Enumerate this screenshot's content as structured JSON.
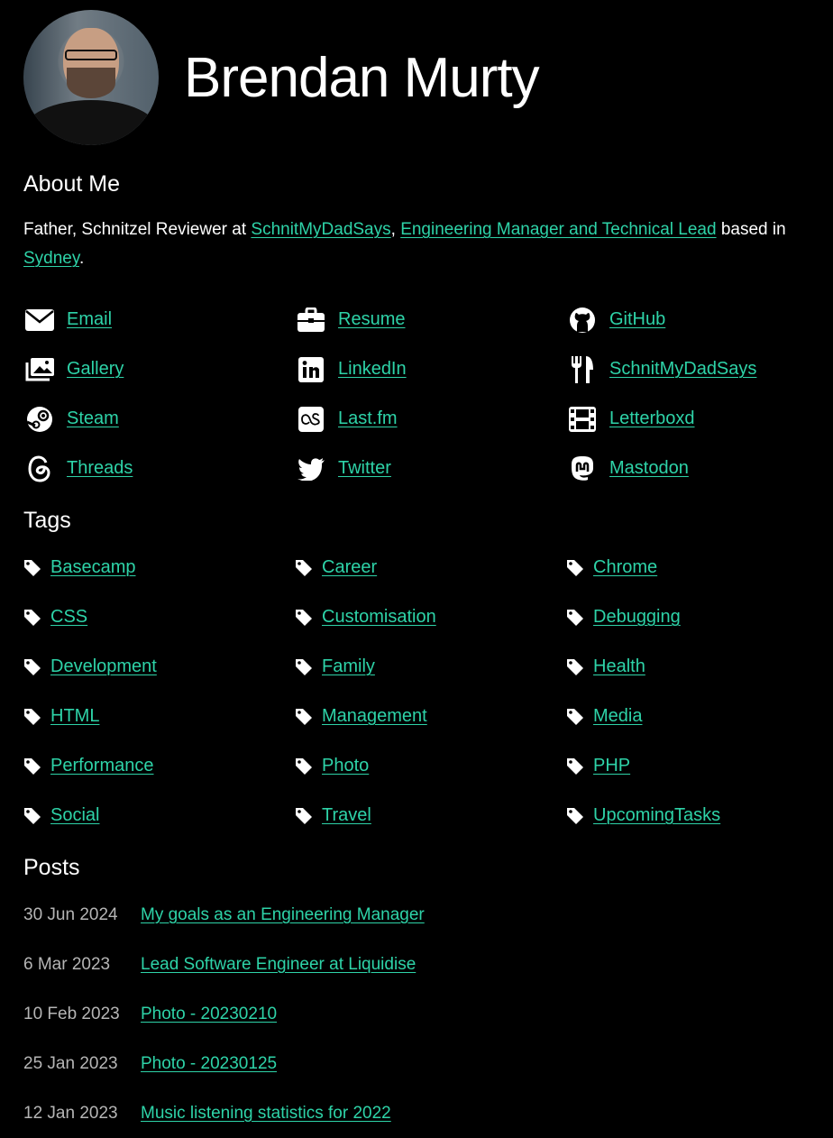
{
  "profile": {
    "name": "Brendan Murty"
  },
  "about": {
    "heading": "About Me",
    "text_1": "Father, Schnitzel Reviewer at ",
    "link_1": "SchnitMyDadSays",
    "text_2": ", ",
    "link_2": "Engineering Manager and Technical Lead",
    "text_3": " based in ",
    "link_3": "Sydney",
    "text_4": "."
  },
  "social": [
    {
      "label": "Email",
      "icon": "email-icon"
    },
    {
      "label": "Resume",
      "icon": "briefcase-icon"
    },
    {
      "label": "GitHub",
      "icon": "github-icon"
    },
    {
      "label": "Gallery",
      "icon": "gallery-icon"
    },
    {
      "label": "LinkedIn",
      "icon": "linkedin-icon"
    },
    {
      "label": "SchnitMyDadSays",
      "icon": "utensils-icon"
    },
    {
      "label": "Steam",
      "icon": "steam-icon"
    },
    {
      "label": "Last.fm",
      "icon": "lastfm-icon"
    },
    {
      "label": "Letterboxd",
      "icon": "film-icon"
    },
    {
      "label": "Threads",
      "icon": "threads-icon"
    },
    {
      "label": "Twitter",
      "icon": "twitter-icon"
    },
    {
      "label": "Mastodon",
      "icon": "mastodon-icon"
    }
  ],
  "tags": {
    "heading": "Tags",
    "items": [
      "Basecamp",
      "Career",
      "Chrome",
      "CSS",
      "Customisation",
      "Debugging",
      "Development",
      "Family",
      "Health",
      "HTML",
      "Management",
      "Media",
      "Performance",
      "Photo",
      "PHP",
      "Social",
      "Travel",
      "UpcomingTasks"
    ]
  },
  "posts": {
    "heading": "Posts",
    "items": [
      {
        "date": "30 Jun 2024",
        "title": "My goals as an Engineering Manager"
      },
      {
        "date": "6 Mar 2023",
        "title": "Lead Software Engineer at Liquidise"
      },
      {
        "date": "10 Feb 2023",
        "title": "Photo - 20230210"
      },
      {
        "date": "25 Jan 2023",
        "title": "Photo - 20230125"
      },
      {
        "date": "12 Jan 2023",
        "title": "Music listening statistics for 2022"
      }
    ]
  },
  "colors": {
    "link": "#2ed3a8",
    "background": "#000000",
    "text": "#ffffff",
    "date": "#b5b5b5"
  }
}
